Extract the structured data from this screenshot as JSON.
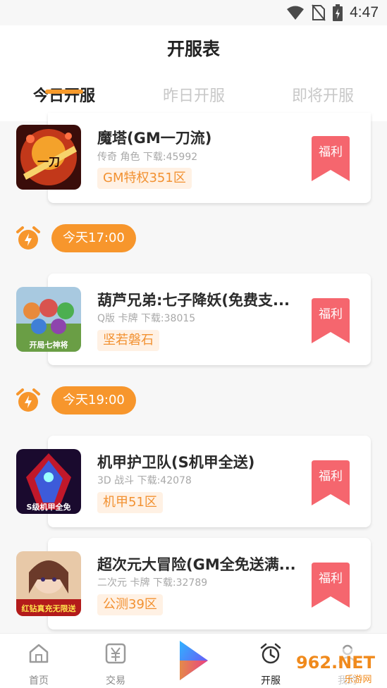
{
  "status_bar": {
    "time": "4:47",
    "icons": [
      "wifi-icon",
      "no-sim-icon",
      "battery-charging-icon"
    ]
  },
  "header": {
    "title": "开服表"
  },
  "tabs": [
    {
      "label": "今日开服",
      "active": true
    },
    {
      "label": "昨日开服",
      "active": false
    },
    {
      "label": "即将开服",
      "active": false
    }
  ],
  "accent_color": "#f7962c",
  "badge_color": "#f5666e",
  "games": [
    {
      "title": "魔塔(GM一刀流)",
      "meta": "传奇 角色 下载:45992",
      "server": "GM特权351区",
      "badge": "福利",
      "thumb_text": "一刀"
    },
    {
      "title": "葫芦兄弟:七子降妖(免费支...",
      "meta": "Q版 卡牌 下载:38015",
      "server": "坚若磐石",
      "badge": "福利",
      "thumb_text": "开局七神将"
    },
    {
      "title": "机甲护卫队(S机甲全送)",
      "meta": "3D 战斗 下载:42078",
      "server": "机甲51区",
      "badge": "福利",
      "thumb_text": "S级机甲全免"
    },
    {
      "title": "超次元大冒险(GM全免送满...",
      "meta": "二次元 卡牌 下载:32789",
      "server": "公测39区",
      "badge": "福利",
      "thumb_text": "红钻真充无限送"
    }
  ],
  "time_slots": [
    {
      "label": "今天17:00"
    },
    {
      "label": "今天19:00"
    }
  ],
  "bottom_nav": [
    {
      "label": "首页",
      "icon": "home-icon"
    },
    {
      "label": "交易",
      "icon": "yen-trade-icon"
    },
    {
      "label": "",
      "icon": "play-logo-icon"
    },
    {
      "label": "开服",
      "icon": "alarm-clock-icon",
      "active": true
    },
    {
      "label": "我的",
      "icon": "user-icon"
    }
  ],
  "watermark": {
    "main": "962.NET",
    "sub": "乐游网"
  }
}
